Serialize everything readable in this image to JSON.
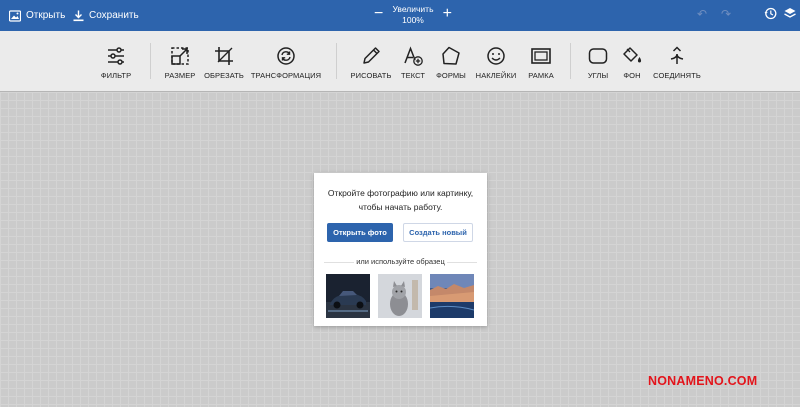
{
  "topbar": {
    "open_label": "Открыть",
    "save_label": "Сохранить",
    "zoom_label": "Увеличить",
    "zoom_value": "100%",
    "zoom_minus": "−",
    "zoom_plus": "+",
    "undo_glyph": "↶",
    "redo_glyph": "↷",
    "icons": [
      "open-icon",
      "download-icon",
      "history-icon",
      "layers-icon"
    ]
  },
  "toolbar": {
    "tools": [
      {
        "id": "filter",
        "label": "ФИЛЬТР",
        "icon": "sliders-icon"
      },
      {
        "id": "resize",
        "label": "РАЗМЕР",
        "icon": "resize-icon"
      },
      {
        "id": "crop",
        "label": "ОБРЕЗАТЬ",
        "icon": "crop-icon"
      },
      {
        "id": "transform",
        "label": "ТРАНСФОРМАЦИЯ",
        "icon": "rotate-icon"
      },
      {
        "id": "draw",
        "label": "РИСОВАТЬ",
        "icon": "pencil-icon"
      },
      {
        "id": "text",
        "label": "ТЕКСТ",
        "icon": "text-add-icon"
      },
      {
        "id": "shapes",
        "label": "ФОРМЫ",
        "icon": "pentagon-icon"
      },
      {
        "id": "stickers",
        "label": "НАКЛЕЙКИ",
        "icon": "smiley-icon"
      },
      {
        "id": "frame",
        "label": "РАМКА",
        "icon": "frame-icon"
      },
      {
        "id": "corners",
        "label": "УГЛЫ",
        "icon": "rounded-square-icon"
      },
      {
        "id": "background",
        "label": "ФОН",
        "icon": "paint-bucket-icon"
      },
      {
        "id": "merge",
        "label": "СОЕДИНЯТЬ",
        "icon": "merge-icon"
      }
    ]
  },
  "dialog": {
    "message_line1": "Откройте фотографию или картинку,",
    "message_line2": "чтобы начать работу.",
    "open_photo": "Открыть фото",
    "create_new": "Создать новый",
    "sample_text": "или используйте образец",
    "samples": [
      "car",
      "cat",
      "city-coast"
    ]
  },
  "watermark": "NONAMENO.COM",
  "colors": {
    "brand_blue": "#2d64ad",
    "toolbar_bg": "#ebebeb",
    "canvas_bg": "#cbcbcb",
    "watermark": "#e3141b"
  }
}
